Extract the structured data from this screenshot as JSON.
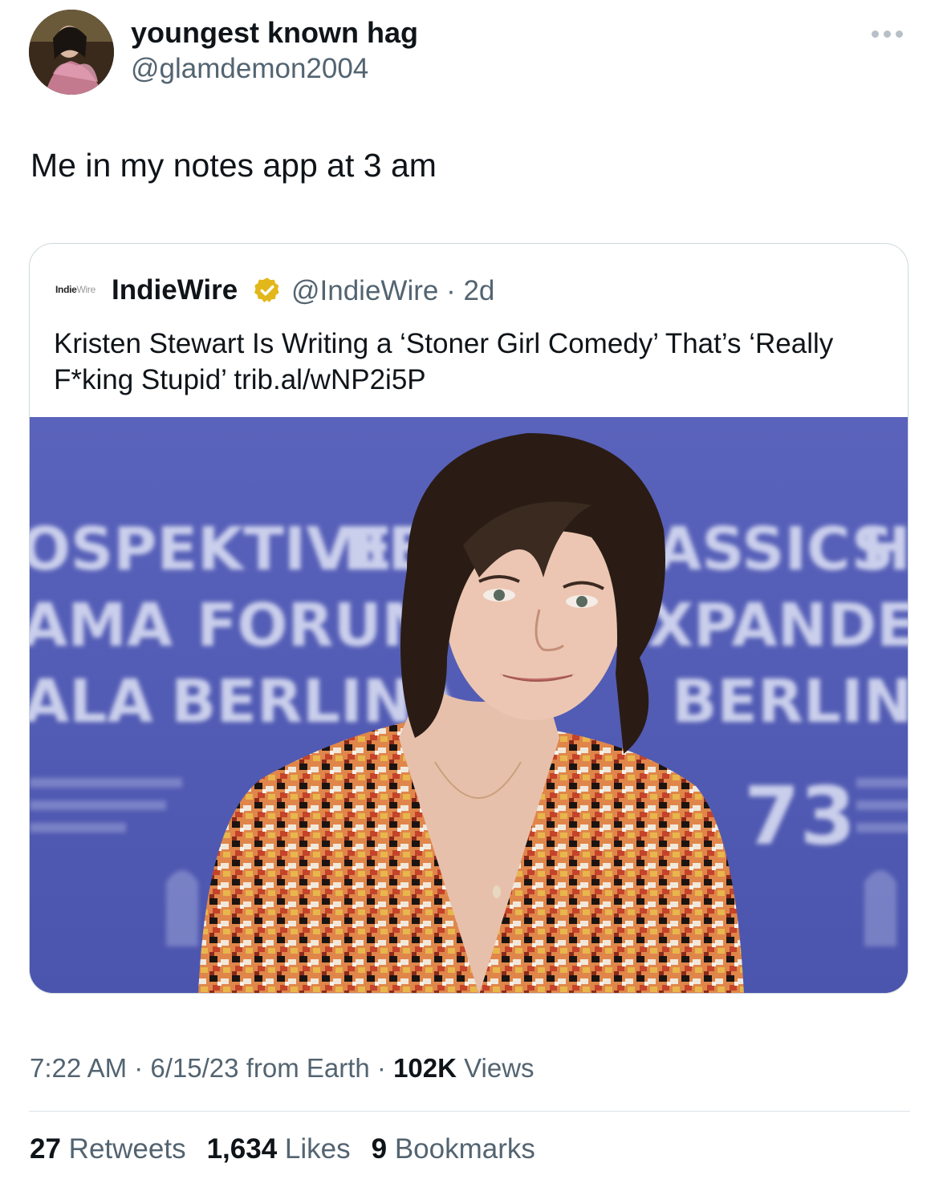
{
  "author": {
    "display_name": "youngest known hag",
    "handle": "@glamdemon2004"
  },
  "more_icon": "more-horizontal-icon",
  "tweet": {
    "text": "Me in my notes app at 3 am"
  },
  "quoted": {
    "logo_text_a": "Indie",
    "logo_text_b": "Wire",
    "name": "IndieWire",
    "verified_icon": "verified-badge-icon",
    "verified_color": "#e2b719",
    "meta": "@IndieWire · 2d",
    "text": "Kristen Stewart Is Writing a ‘Stoner Girl Comedy’ That’s ‘Really F*king Stupid’ trib.al/wNP2i5P",
    "backdrop_words": [
      "OSPEKTIVE",
      "BE",
      "ASSICS",
      "HO",
      "AMA",
      "FORUM",
      "XPANDED",
      "ALA",
      "BERLINA",
      "BERLINALE",
      "73"
    ]
  },
  "footer": {
    "time": "7:22 AM",
    "date": "6/15/23",
    "source": "from Earth",
    "views_count": "102K",
    "views_label": "Views",
    "retweets_count": "27",
    "retweets_label": "Retweets",
    "likes_count": "1,634",
    "likes_label": "Likes",
    "bookmarks_count": "9",
    "bookmarks_label": "Bookmarks"
  }
}
